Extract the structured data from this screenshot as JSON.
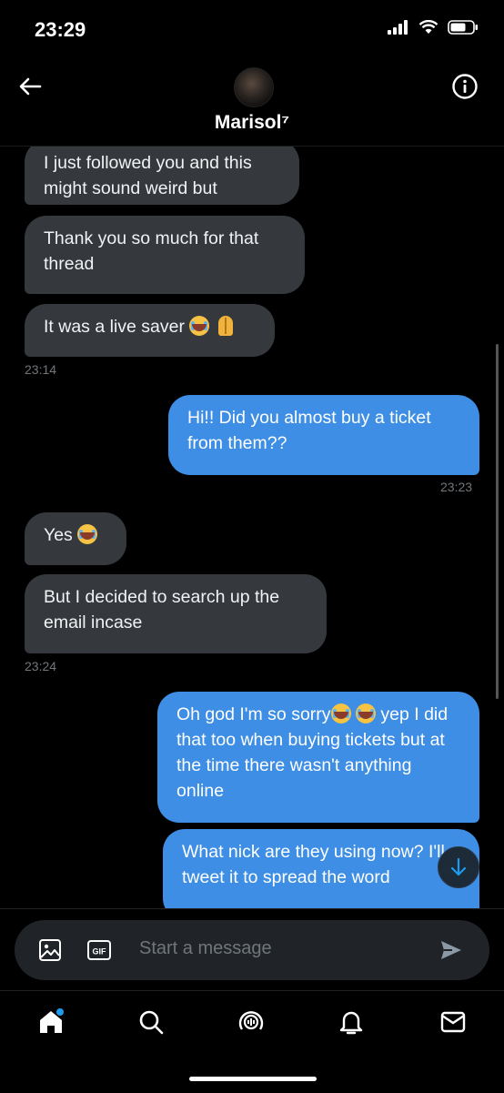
{
  "status_bar": {
    "time": "23:29"
  },
  "header": {
    "contact_name": "Marisol⁷"
  },
  "messages": [
    {
      "side": "in",
      "text": "I just followed you and this might sound weird but"
    },
    {
      "side": "in",
      "text": "Thank you so much for that thread"
    },
    {
      "side": "in",
      "text": "It was a live saver"
    },
    {
      "time": "23:14"
    },
    {
      "side": "out",
      "text": "Hi!! Did you almost buy a ticket from them??"
    },
    {
      "time": "23:23"
    },
    {
      "side": "in",
      "text": "Yes"
    },
    {
      "side": "in",
      "text": "But I decided to search up the email incase"
    },
    {
      "time": "23:24"
    },
    {
      "side": "out",
      "text_a": "Oh god I'm so sorry",
      "text_b": "yep I did that too when buying tickets but at the time there wasn't anything online"
    },
    {
      "side": "out",
      "text": "What nick are they using now? I'll tweet it to spread the word"
    }
  ],
  "composer": {
    "placeholder": "Start a message"
  },
  "icons": [
    "back-arrow-icon",
    "info-icon",
    "image-icon",
    "gif-icon",
    "send-icon",
    "home-icon",
    "search-icon",
    "spaces-icon",
    "notifications-icon",
    "messages-icon",
    "scroll-down-icon"
  ],
  "colors": {
    "outgoing_bubble": "#3d8ee4",
    "incoming_bubble": "#35383d",
    "accent": "#1d9bf0"
  }
}
